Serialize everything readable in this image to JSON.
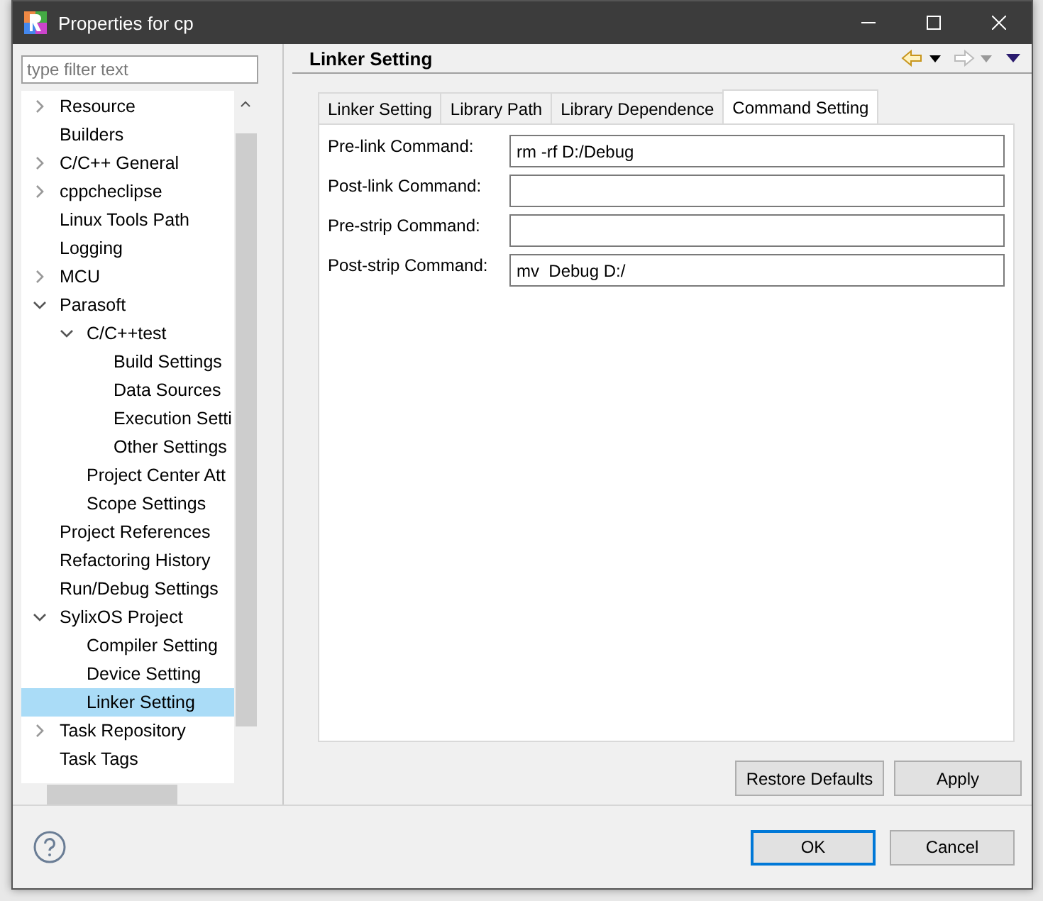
{
  "window": {
    "title": "Properties for cp"
  },
  "filter": {
    "placeholder": "type filter text"
  },
  "tree": [
    {
      "label": "Resource",
      "expanded": false,
      "selected": false
    },
    {
      "label": "Builders",
      "selected": false
    },
    {
      "label": "C/C++ General",
      "expanded": false,
      "selected": false
    },
    {
      "label": "cppcheclipse",
      "expanded": false,
      "selected": false
    },
    {
      "label": "Linux Tools Path",
      "selected": false
    },
    {
      "label": "Logging",
      "selected": false
    },
    {
      "label": "MCU",
      "expanded": false,
      "selected": false
    },
    {
      "label": "Parasoft",
      "expanded": true,
      "selected": false,
      "children": [
        {
          "label": "C/C++test",
          "expanded": true,
          "selected": false,
          "children": [
            {
              "label": "Build Settings",
              "selected": false
            },
            {
              "label": "Data Sources",
              "selected": false
            },
            {
              "label": "Execution Setti",
              "selected": false
            },
            {
              "label": "Other Settings",
              "selected": false
            }
          ]
        },
        {
          "label": "Project Center Att",
          "selected": false
        },
        {
          "label": "Scope Settings",
          "selected": false
        }
      ]
    },
    {
      "label": "Project References",
      "selected": false
    },
    {
      "label": "Refactoring History",
      "selected": false
    },
    {
      "label": "Run/Debug Settings",
      "selected": false
    },
    {
      "label": "SylixOS Project",
      "expanded": true,
      "selected": false,
      "children": [
        {
          "label": "Compiler Setting",
          "selected": false
        },
        {
          "label": "Device Setting",
          "selected": false
        },
        {
          "label": "Linker Setting",
          "selected": true
        }
      ]
    },
    {
      "label": "Task Repository",
      "expanded": false,
      "selected": false
    },
    {
      "label": "Task Tags",
      "selected": false
    }
  ],
  "page": {
    "title": "Linker Setting"
  },
  "tabs": [
    {
      "label": "Linker Setting",
      "selected": false
    },
    {
      "label": "Library Path",
      "selected": false
    },
    {
      "label": "Library Dependence",
      "selected": false
    },
    {
      "label": "Command Setting",
      "selected": true
    }
  ],
  "fields": [
    {
      "label": "Pre-link Command:",
      "value": "rm -rf D:/Debug"
    },
    {
      "label": "Post-link Command:"
    },
    {
      "label": "Pre-strip Command:"
    },
    {
      "label": "Post-strip Command:",
      "value": "mv  Debug D:/"
    }
  ],
  "page_buttons": [
    "Restore Defaults",
    "Apply"
  ],
  "dialog_buttons": [
    {
      "label": "OK",
      "default": true
    },
    {
      "label": "Cancel",
      "default": false
    }
  ]
}
